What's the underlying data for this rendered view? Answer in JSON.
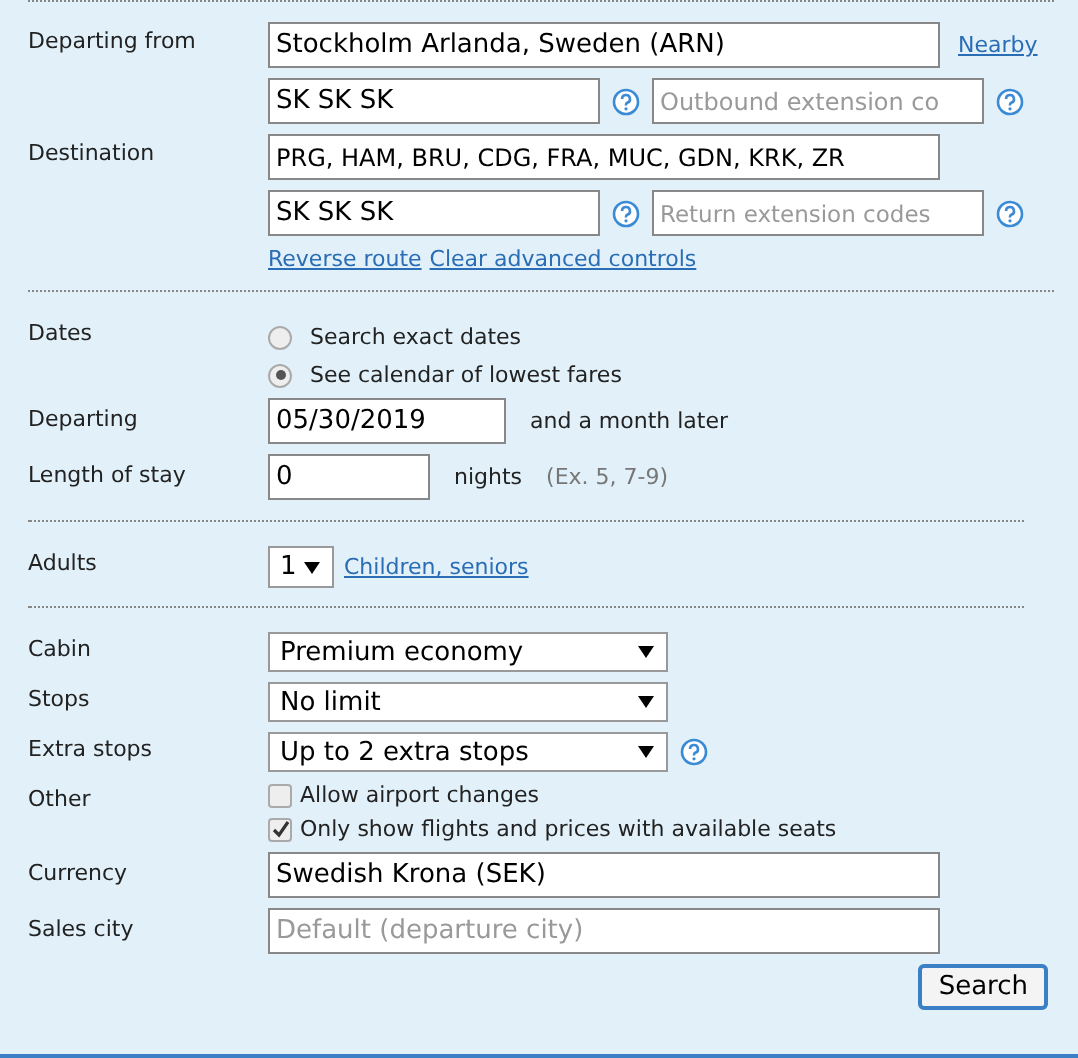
{
  "route": {
    "departing_label": "Departing from",
    "departing_value": "Stockholm Arlanda, Sweden (ARN)",
    "nearby_link": "Nearby",
    "outbound_codes": {
      "value": "SK SK SK",
      "extension_placeholder": "Outbound extension co"
    },
    "destination_label": "Destination",
    "destination_value": "PRG, HAM, BRU, CDG, FRA, MUC, GDN, KRK, ZR",
    "return_codes": {
      "value": "SK SK SK",
      "extension_placeholder": "Return extension codes"
    },
    "links": [
      "Reverse route",
      "Clear advanced controls"
    ]
  },
  "dates": {
    "label": "Dates",
    "options": [
      {
        "label": "Search exact dates",
        "selected": false
      },
      {
        "label": "See calendar of lowest fares",
        "selected": true
      }
    ],
    "departing_label": "Departing",
    "departing_value": "05/30/2019",
    "departing_note": "and a month later",
    "stay_label": "Length of stay",
    "stay_value": "0",
    "stay_unit": "nights",
    "stay_hint": "(Ex. 5, 7-9)"
  },
  "passengers": {
    "adults_label": "Adults",
    "adults_value": "1",
    "more_link": "Children, seniors"
  },
  "options": {
    "selects": [
      {
        "label": "Cabin",
        "value": "Premium economy",
        "help": false
      },
      {
        "label": "Stops",
        "value": "No limit",
        "help": false
      },
      {
        "label": "Extra stops",
        "value": "Up to 2 extra stops",
        "help": true
      }
    ],
    "other_label": "Other",
    "checks": [
      {
        "label": "Allow airport changes",
        "checked": false
      },
      {
        "label": "Only show flights and prices with available seats",
        "checked": true
      }
    ],
    "currency_label": "Currency",
    "currency_value": "Swedish Krona (SEK)",
    "sales_city_label": "Sales city",
    "sales_city_placeholder": "Default (departure city)"
  },
  "search_button": "Search"
}
